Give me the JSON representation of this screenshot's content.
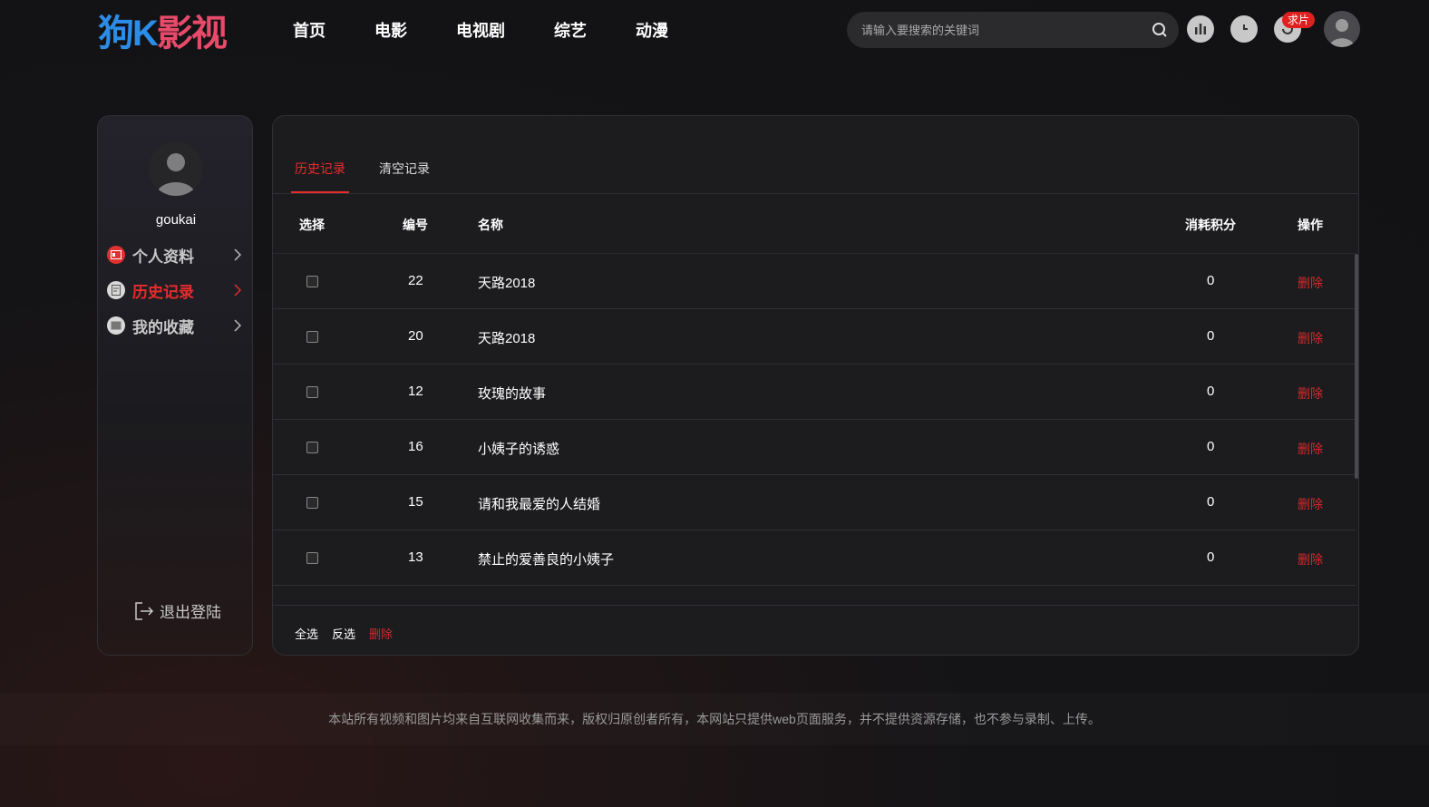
{
  "logo": {
    "part1": "狗K",
    "k": "K",
    "part2": "影视"
  },
  "nav": [
    "首页",
    "电影",
    "电视剧",
    "综艺",
    "动漫"
  ],
  "search": {
    "placeholder": "请输入要搜索的关键词"
  },
  "header": {
    "badge": "求片"
  },
  "user": {
    "name": "goukai"
  },
  "sidebar": {
    "items": [
      {
        "label": "个人资料",
        "icon": "id-card-icon",
        "color": "#e03030"
      },
      {
        "label": "历史记录",
        "icon": "history-icon",
        "color": "#d8d8d8"
      },
      {
        "label": "我的收藏",
        "icon": "favorite-icon",
        "color": "#d8d8d8"
      }
    ],
    "logout": "退出登陆"
  },
  "tabs": [
    "历史记录",
    "清空记录"
  ],
  "table": {
    "headers": {
      "select": "选择",
      "id": "编号",
      "name": "名称",
      "points": "消耗积分",
      "action": "操作"
    },
    "rows": [
      {
        "id": "22",
        "name": "天路2018",
        "points": "0",
        "action": "删除"
      },
      {
        "id": "20",
        "name": "天路2018",
        "points": "0",
        "action": "删除"
      },
      {
        "id": "12",
        "name": "玫瑰的故事",
        "points": "0",
        "action": "删除"
      },
      {
        "id": "16",
        "name": "小姨子的诱惑",
        "points": "0",
        "action": "删除"
      },
      {
        "id": "15",
        "name": "请和我最爱的人结婚",
        "points": "0",
        "action": "删除"
      },
      {
        "id": "13",
        "name": "禁止的爱善良的小姨子",
        "points": "0",
        "action": "删除"
      }
    ]
  },
  "footbar": {
    "select_all": "全选",
    "invert": "反选",
    "delete": "删除"
  },
  "copyright": "本站所有视频和图片均来自互联网收集而来，版权归原创者所有，本网站只提供web页面服务，并不提供资源存储，也不参与录制、上传。",
  "colors": {
    "accent": "#e82c2c",
    "logo_blue": "#2b8de8",
    "logo_pink": "#e84a6a"
  }
}
